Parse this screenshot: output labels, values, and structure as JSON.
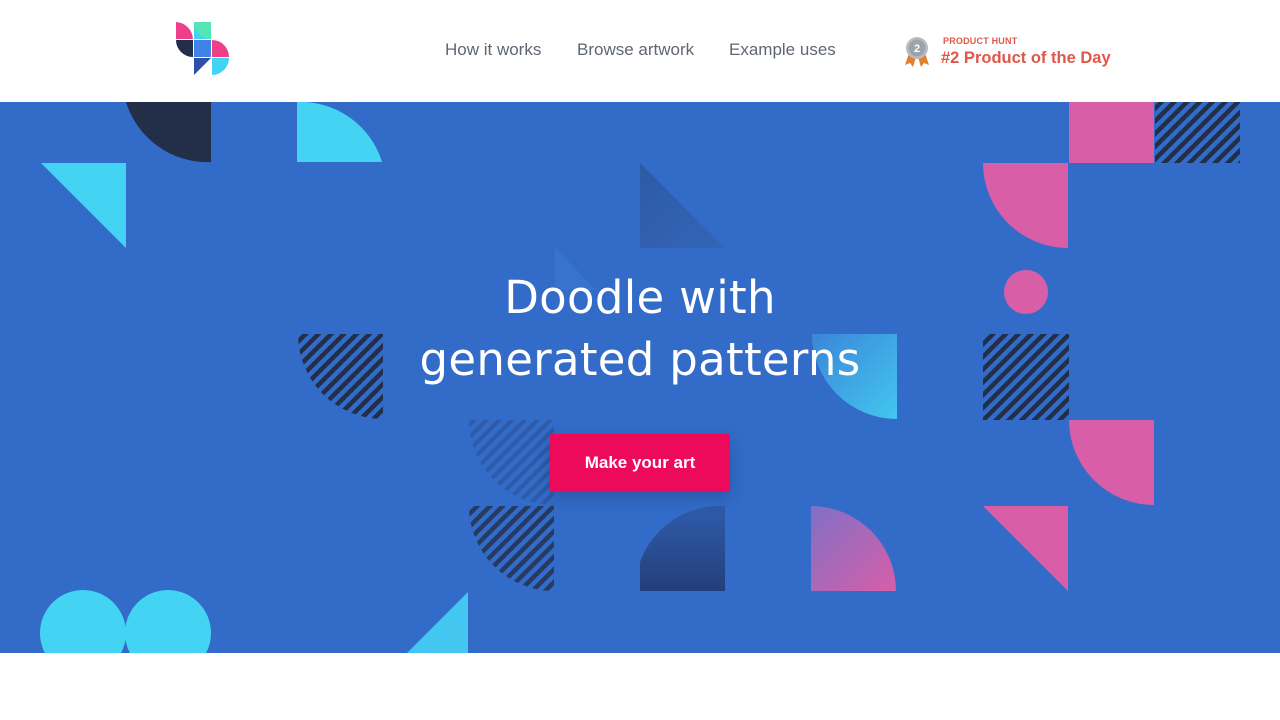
{
  "nav": {
    "links": [
      {
        "label": "How it works"
      },
      {
        "label": "Browse artwork"
      },
      {
        "label": "Example uses"
      }
    ]
  },
  "badge": {
    "rank": "2",
    "kicker": "PRODUCT HUNT",
    "title": "#2 Product of the Day",
    "color": "#e0574a"
  },
  "hero": {
    "headline_line1": "Doodle with",
    "headline_line2": "generated patterns",
    "cta_label": "Make your art",
    "background": "#326cc8",
    "cta_color": "#ee0a5a"
  },
  "palette": {
    "cyan": "#43d4f4",
    "navy": "#232e48",
    "pink": "#d85ea8"
  },
  "icons": {
    "logo": "app-logo-icon",
    "medal": "silver-medal-icon"
  }
}
